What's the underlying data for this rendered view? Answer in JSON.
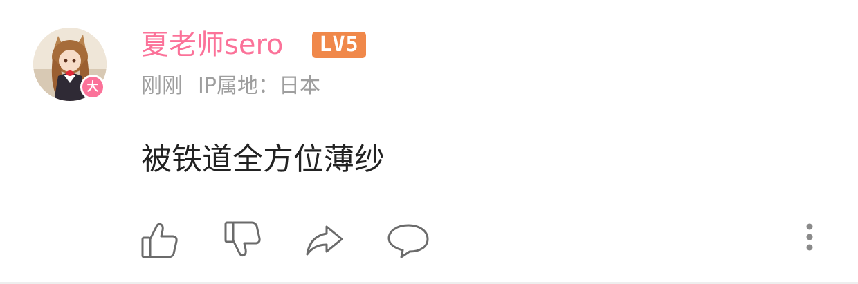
{
  "comment": {
    "user": {
      "name": "夏老师sero",
      "level": "LV5",
      "vip_badge": "大",
      "name_color": "#fb7299"
    },
    "meta": {
      "time": "刚刚",
      "ip_location": "IP属地：日本"
    },
    "text": "被铁道全方位薄纱",
    "actions": {
      "like_icon": "thumbs-up-icon",
      "dislike_icon": "thumbs-down-icon",
      "share_icon": "share-arrow-icon",
      "reply_icon": "speech-bubble-icon",
      "more_icon": "vertical-ellipsis-icon"
    }
  }
}
